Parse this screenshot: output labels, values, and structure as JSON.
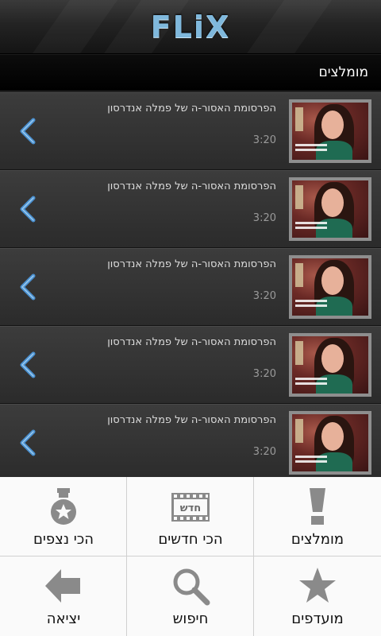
{
  "header": {
    "logo_text": "FLiX"
  },
  "section": {
    "title": "מומלצים"
  },
  "items": [
    {
      "title": "הפרסומת האסור-ה של פמלה אנדרסון",
      "duration": "3:20"
    },
    {
      "title": "הפרסומת האסור-ה של פמלה אנדרסון",
      "duration": "3:20"
    },
    {
      "title": "הפרסומת האסור-ה של פמלה אנדרסון",
      "duration": "3:20"
    },
    {
      "title": "הפרסומת האסור-ה של פמלה אנדרסון",
      "duration": "3:20"
    },
    {
      "title": "הפרסומת האסור-ה של פמלה אנדרסון",
      "duration": "3:20"
    }
  ],
  "menu": {
    "most_viewed": "הכי נצפים",
    "newest": "הכי חדשים",
    "newest_badge": "חדש",
    "recommended": "מומלצים",
    "exit": "יציאה",
    "search": "חיפוש",
    "favorites": "מועדפים"
  },
  "colors": {
    "accent": "#7fb8dc",
    "chevron": "#4a90d0",
    "menu_icon": "#8a8a8a"
  }
}
